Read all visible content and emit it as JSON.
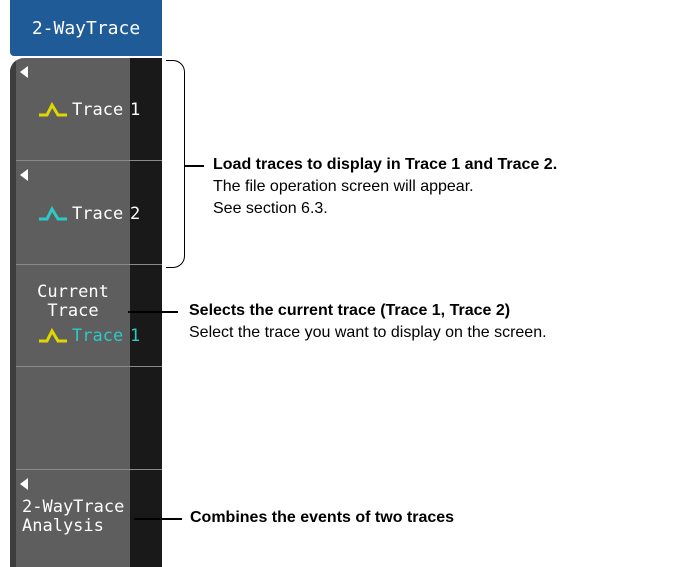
{
  "menu": {
    "title": "2-WayTrace",
    "trace1": {
      "label": "Trace",
      "number": "1"
    },
    "trace2": {
      "label": "Trace",
      "number": "2"
    },
    "current_trace": {
      "label_line1": "Current",
      "label_line2": "Trace",
      "value_label": "Trace",
      "value_number": "1"
    },
    "analysis": {
      "line1": "2-WayTrace",
      "line2": "Analysis"
    }
  },
  "annotations": {
    "load": {
      "heading": "Load traces to display in Trace 1 and Trace 2.",
      "line1": "The file operation screen will appear.",
      "line2": "See section 6.3."
    },
    "select": {
      "heading": "Selects the current trace (Trace 1, Trace 2)",
      "line1": "Select the trace you want to display on the screen."
    },
    "combine": {
      "heading": "Combines the events of two traces"
    }
  },
  "colors": {
    "trace1": "#e1d700",
    "trace2": "#2ec8c8",
    "title_bg": "#1f5b96",
    "panel": "#5e5e5e"
  },
  "icons": {
    "trace1": "trace-waveform-icon",
    "trace2": "trace-waveform-icon",
    "submenu": "left-arrow-icon"
  }
}
